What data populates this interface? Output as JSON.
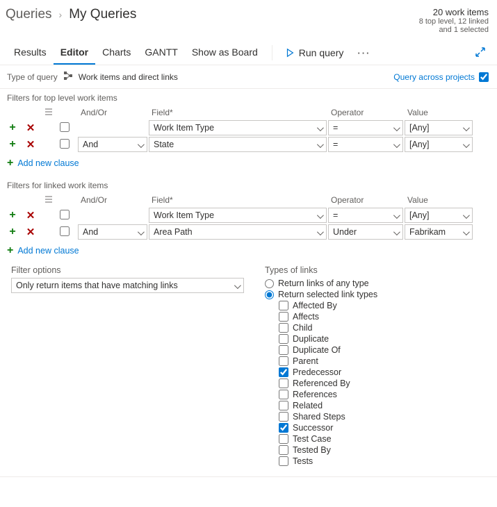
{
  "breadcrumb": {
    "root": "Queries",
    "current": "My Queries"
  },
  "stats": {
    "count": "20 work items",
    "detail1": "8 top level, 12 linked",
    "detail2": "and 1 selected"
  },
  "tabs": {
    "results": "Results",
    "editor": "Editor",
    "charts": "Charts",
    "gantt": "GANTT",
    "board": "Show as Board",
    "run": "Run query"
  },
  "typeOfQuery": {
    "label": "Type of query",
    "value": "Work items and direct links"
  },
  "queryAcross": "Query across projects",
  "headers": {
    "andor": "And/Or",
    "field": "Field*",
    "operator": "Operator",
    "value": "Value"
  },
  "topSection": {
    "title": "Filters for top level work items",
    "rows": [
      {
        "andor": "",
        "field": "Work Item Type",
        "operator": "=",
        "value": "[Any]"
      },
      {
        "andor": "And",
        "field": "State",
        "operator": "=",
        "value": "[Any]"
      }
    ],
    "add": "Add new clause"
  },
  "linkedSection": {
    "title": "Filters for linked work items",
    "rows": [
      {
        "andor": "",
        "field": "Work Item Type",
        "operator": "=",
        "value": "[Any]"
      },
      {
        "andor": "And",
        "field": "Area Path",
        "operator": "Under",
        "value": "Fabrikam"
      }
    ],
    "add": "Add new clause"
  },
  "filterOptions": {
    "label": "Filter options",
    "value": "Only return items that have matching links"
  },
  "linkTypes": {
    "label": "Types of links",
    "radioAny": "Return links of any type",
    "radioSelected": "Return selected link types",
    "items": [
      {
        "label": "Affected By",
        "checked": false
      },
      {
        "label": "Affects",
        "checked": false
      },
      {
        "label": "Child",
        "checked": false
      },
      {
        "label": "Duplicate",
        "checked": false
      },
      {
        "label": "Duplicate Of",
        "checked": false
      },
      {
        "label": "Parent",
        "checked": false
      },
      {
        "label": "Predecessor",
        "checked": true
      },
      {
        "label": "Referenced By",
        "checked": false
      },
      {
        "label": "References",
        "checked": false
      },
      {
        "label": "Related",
        "checked": false
      },
      {
        "label": "Shared Steps",
        "checked": false
      },
      {
        "label": "Successor",
        "checked": true
      },
      {
        "label": "Test Case",
        "checked": false
      },
      {
        "label": "Tested By",
        "checked": false
      },
      {
        "label": "Tests",
        "checked": false
      }
    ]
  }
}
